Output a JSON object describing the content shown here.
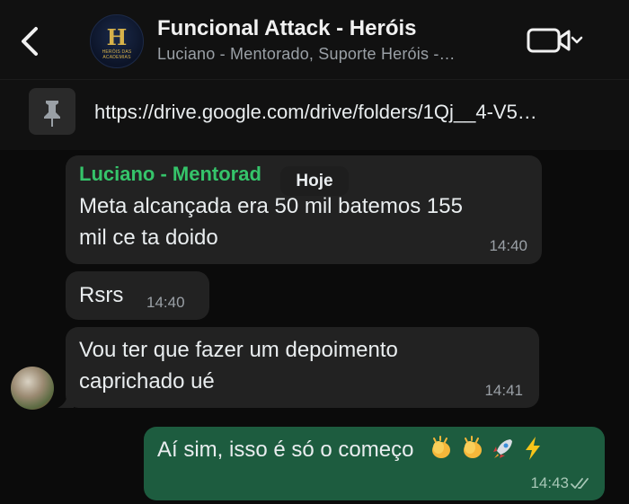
{
  "header": {
    "title": "Funcional Attack - Heróis",
    "subtitle": "Luciano - Mentorado, Suporte Heróis -…",
    "group_logo_text": "HERÓIS DAS ACADEMIAS"
  },
  "pinned": {
    "url": "https://drive.google.com/drive/folders/1Qj__4-V5…"
  },
  "date_separator": "Hoje",
  "messages": [
    {
      "sender": "Luciano - Mentorad",
      "text_line1": "Meta alcançada era 50 mil batemos 155",
      "text_line2": "mil ce ta doido",
      "time": "14:40"
    },
    {
      "text": "Rsrs",
      "time": "14:40"
    },
    {
      "text_line1": "Vou ter que fazer um depoimento",
      "text_line2": "caprichado ué",
      "time": "14:41"
    },
    {
      "text": "Aí sim, isso é só o começo",
      "emojis": "clapping-hands, clapping-hands, rocket, high-voltage",
      "time": "14:43",
      "status": "read"
    }
  ],
  "colors": {
    "incoming_bubble": "#222222",
    "outgoing_bubble": "#1d5c3f",
    "sender_name": "#35c46a",
    "background": "#0b0b0b"
  }
}
